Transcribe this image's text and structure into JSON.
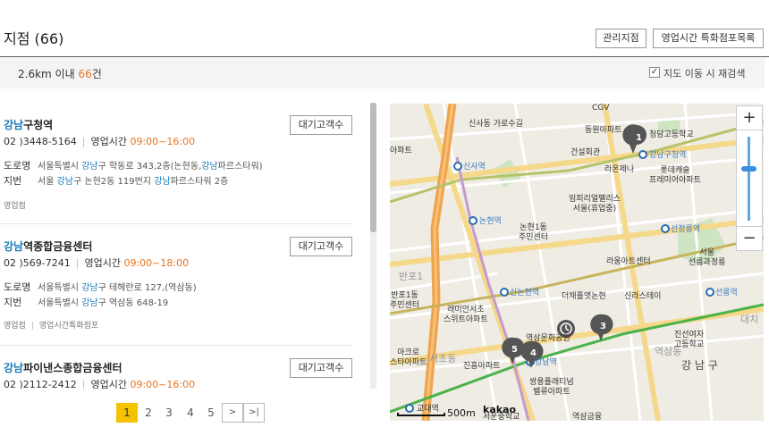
{
  "header": {
    "title": "지점 (66)",
    "btn_mgmt": "관리지점",
    "btn_hours": "영업시간 특화점포목록"
  },
  "filter": {
    "prefix": "2.6km 이내 ",
    "count": "66",
    "suffix": "건",
    "checkbox_mark": "✓",
    "checkbox_label": "지도 이동 시 재검색"
  },
  "branches": [
    {
      "name_hl": "강남",
      "name_rest": "구청역",
      "queue": "대기고객수",
      "phone": "02 )3448-5164",
      "hours_label": "영업시간",
      "hours": "09:00~16:00",
      "road_label": "도로명",
      "road_pre": "서울특별시 ",
      "road_hl": "강남",
      "road_mid": "구 학동로 343,2층(논현동,",
      "road_hl2": "강남",
      "road_post": "파르스타워)",
      "lot_label": "지번",
      "lot_pre": "서울 ",
      "lot_hl": "강남",
      "lot_mid": "구 논현2동 119번지 ",
      "lot_hl2": "강남",
      "lot_post": "파르스타워 2층",
      "tags": [
        "영업점"
      ]
    },
    {
      "name_hl": "강남",
      "name_rest": "역종합금융센터",
      "queue": "대기고객수",
      "phone": "02 )569-7241",
      "hours_label": "영업시간",
      "hours": "09:00~18:00",
      "road_label": "도로명",
      "road_pre": "서울특별시 ",
      "road_hl": "강남",
      "road_mid": "구 테헤란로 127,(역삼동)",
      "road_hl2": "",
      "road_post": "",
      "lot_label": "지번",
      "lot_pre": "서울특별시 ",
      "lot_hl": "강남",
      "lot_mid": "구 역삼동 648-19",
      "lot_hl2": "",
      "lot_post": "",
      "tags": [
        "영업점",
        "영업시간특화점포"
      ]
    },
    {
      "name_hl": "강남",
      "name_rest": "파이낸스종합금융센터",
      "queue": "대기고객수",
      "phone": "02 )2112-2412",
      "hours_label": "영업시간",
      "hours": "09:00~16:00"
    }
  ],
  "pager": {
    "pages": [
      "1",
      "2",
      "3",
      "4",
      "5"
    ],
    "next": ">",
    "last": ">|"
  },
  "map": {
    "labels": {
      "sinsa_garosu": "신사동\n가로수길",
      "dongwon_apt": "동원아파트",
      "gangnam_gu_office": "강남구청역",
      "cgv": "CGV",
      "cheongdam_school": "청담고등학교",
      "geonseol_hall": "건설회관",
      "lacena": "라온제나",
      "lotte_castle": "롯데캐슬\n프레미어아파트",
      "sinsa_stn": "신사역",
      "imperial": "임피리얼팰리스\n서울(휴업중)",
      "apt_left": "아파트",
      "nonhyeon_stn": "논현역",
      "nonhyeon1": "논현1동\n주민센터",
      "seonjeongneung_stn": "선정릉역",
      "raum": "라움아트센터",
      "seolleung": "서울\n선릉과정릉",
      "banpo_area": "반포1",
      "banpo1": "반포1동\n주민센터",
      "raemian": "래미안서초\n스위트아파트",
      "sinnonhyeon_stn": "신논현역",
      "theplaza": "더채플앳논현",
      "shilla_stay": "신라스테이",
      "seolleung_stn": "선릉역",
      "jinseon": "진선여자\n고등학교",
      "gangnam_gu": "강 남 구",
      "yeoksam_culture": "역삼문화공원",
      "acro": "아크로\n스타아파트",
      "jinheung": "진흥아파트",
      "gangnam_stn": "강남역",
      "ssangyong": "쌍용플래티넘\n밸류아파트",
      "gyodae_stn": "교대역",
      "yeoksam_dong": "역삼동",
      "seocho_area": "서초동",
      "daechi": "대치",
      "bottom_school": "서운중학교",
      "bottom_yeoksam": "역삼금융"
    },
    "markers": [
      "1",
      "3",
      "4",
      "5"
    ],
    "zoom_in": "+",
    "zoom_out": "−",
    "scale": "500m",
    "brand": "kakao"
  }
}
